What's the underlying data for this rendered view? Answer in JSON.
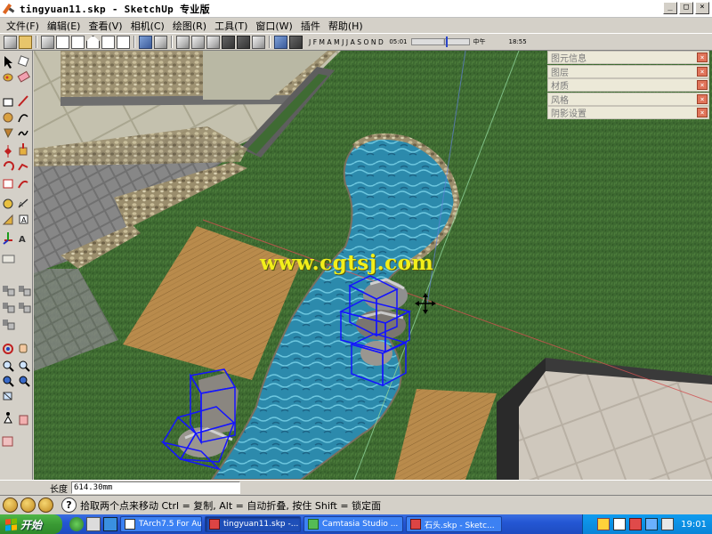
{
  "window": {
    "title": "tingyuan11.skp - SketchUp 专业版",
    "controls": [
      "_",
      "□",
      "×"
    ]
  },
  "menu": [
    "文件(F)",
    "编辑(E)",
    "查看(V)",
    "相机(C)",
    "绘图(R)",
    "工具(T)",
    "窗口(W)",
    "插件",
    "帮助(H)"
  ],
  "shadow_settings": {
    "months": [
      "J",
      "F",
      "M",
      "A",
      "M",
      "J",
      "J",
      "A",
      "S",
      "O",
      "N",
      "D"
    ],
    "time_start": "05:01",
    "time_mid": "中午",
    "time_end": "18:55"
  },
  "tray_panels": [
    "图元信息",
    "图层",
    "材质",
    "风格",
    "阴影设置"
  ],
  "watermark": "www.cgtsj.com",
  "measurements": {
    "label": "长度",
    "value": "614.30mm"
  },
  "status": {
    "message": "拾取两个点来移动 Ctrl = 复制, Alt = 自动折叠, 按住 Shift = 锁定面"
  },
  "taskbar": {
    "start": "开始",
    "tasks": [
      {
        "label": "TArch7.5 For Au...",
        "active": false
      },
      {
        "label": "tingyuan11.skp -...",
        "active": true
      },
      {
        "label": "Camtasia Studio ...",
        "active": false
      },
      {
        "label": "石头.skp - Sketc...",
        "active": false
      }
    ],
    "clock": "19:01"
  },
  "colors": {
    "grass": "#3f6b33",
    "water": "#2f8fb0",
    "wood": "#b88a4e",
    "paving": "#8a8a8a",
    "selection": "#1414ff"
  }
}
